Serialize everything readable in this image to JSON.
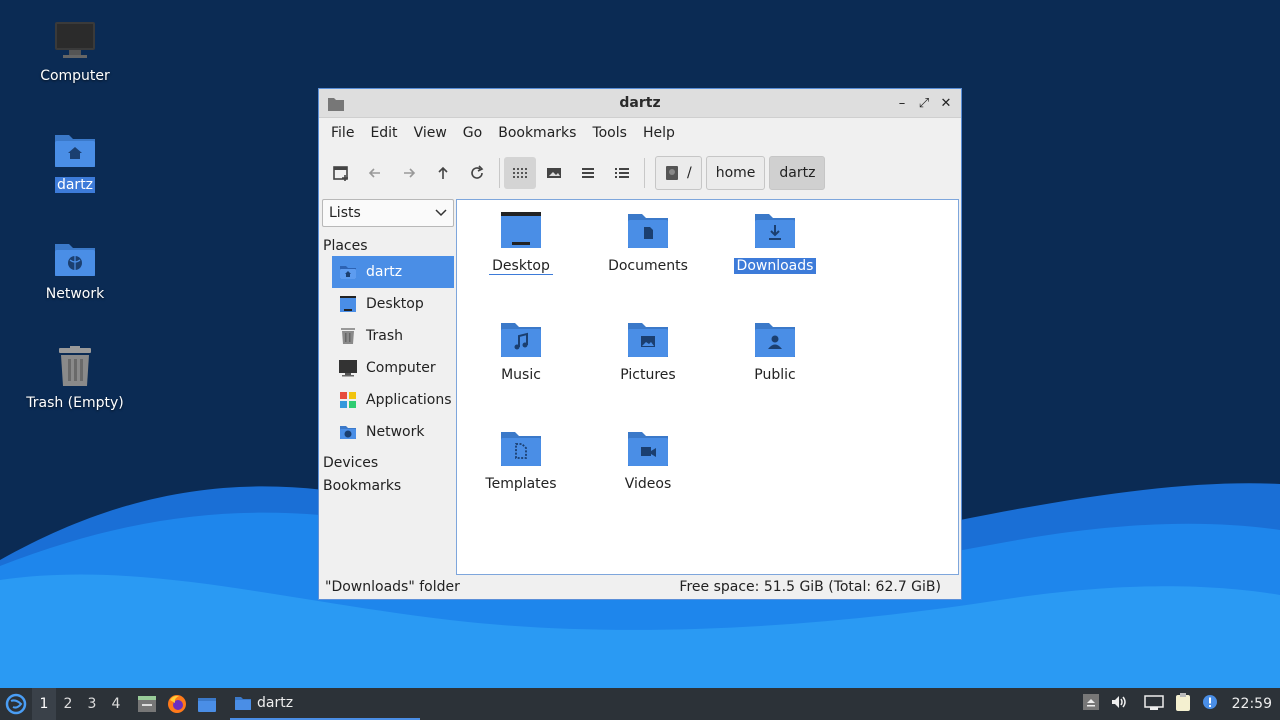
{
  "desktop": {
    "icons": [
      {
        "label": "Computer",
        "icon": "computer-icon"
      },
      {
        "label": "dartz",
        "icon": "home-folder-icon",
        "selected": true
      },
      {
        "label": "Network",
        "icon": "network-folder-icon"
      },
      {
        "label": "Trash (Empty)",
        "icon": "trash-icon"
      }
    ]
  },
  "window": {
    "title": "dartz",
    "menu": [
      "File",
      "Edit",
      "View",
      "Go",
      "Bookmarks",
      "Tools",
      "Help"
    ],
    "breadcrumb": [
      "/",
      "home",
      "dartz"
    ],
    "sidebar": {
      "mode": "Lists",
      "places_header": "Places",
      "places": [
        {
          "label": "dartz",
          "icon": "home-folder-icon",
          "selected": true
        },
        {
          "label": "Desktop",
          "icon": "desktop-icon"
        },
        {
          "label": "Trash",
          "icon": "trash-icon"
        },
        {
          "label": "Computer",
          "icon": "computer-icon"
        },
        {
          "label": "Applications",
          "icon": "applications-icon"
        },
        {
          "label": "Network",
          "icon": "network-folder-icon"
        }
      ],
      "devices": "Devices",
      "bookmarks": "Bookmarks"
    },
    "files": [
      {
        "label": "Desktop",
        "icon": "desktop-folder-icon",
        "focused": true
      },
      {
        "label": "Documents",
        "icon": "documents-folder-icon"
      },
      {
        "label": "Downloads",
        "icon": "downloads-folder-icon",
        "selected": true
      },
      {
        "label": "Music",
        "icon": "music-folder-icon"
      },
      {
        "label": "Pictures",
        "icon": "pictures-folder-icon"
      },
      {
        "label": "Public",
        "icon": "public-folder-icon"
      },
      {
        "label": "Templates",
        "icon": "templates-folder-icon"
      },
      {
        "label": "Videos",
        "icon": "videos-folder-icon"
      }
    ],
    "status_left": "\"Downloads\" folder",
    "status_right": "Free space: 51.5 GiB (Total: 62.7 GiB)"
  },
  "taskbar": {
    "workspaces": [
      "1",
      "2",
      "3",
      "4"
    ],
    "active_workspace": "1",
    "task": "dartz",
    "clock": "22:59"
  },
  "colors": {
    "accent": "#4a8ee6",
    "folder": "#4a8ee6",
    "folder_tab": "#3b79c9"
  }
}
